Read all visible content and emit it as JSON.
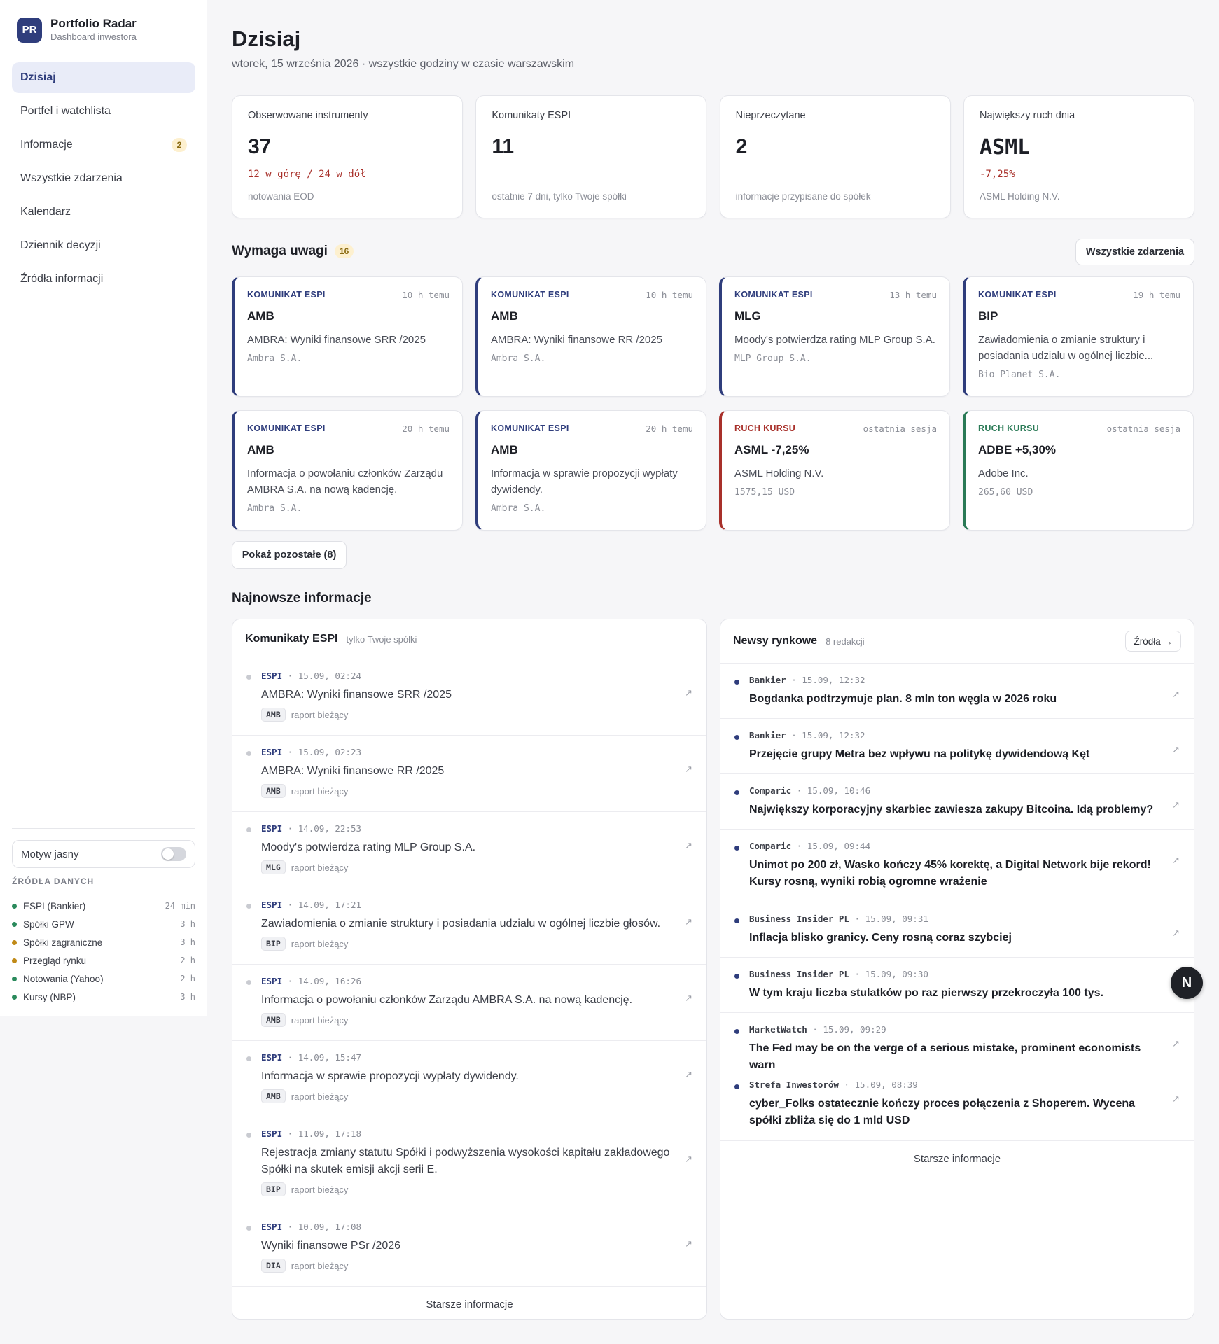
{
  "brand": {
    "logo": "PR",
    "title": "Portfolio Radar",
    "subtitle": "Dashboard inwestora"
  },
  "nav": [
    {
      "label": "Dzisiaj",
      "active": true
    },
    {
      "label": "Portfel i watchlista"
    },
    {
      "label": "Informacje",
      "badge": "2"
    },
    {
      "label": "Wszystkie zdarzenia"
    },
    {
      "label": "Kalendarz"
    },
    {
      "label": "Dziennik decyzji"
    },
    {
      "label": "Źródła informacji"
    }
  ],
  "theme": {
    "label": "Motyw jasny",
    "enabled": false
  },
  "sources": {
    "heading": "ŹRÓDŁA DANYCH",
    "items": [
      {
        "name": "ESPI (Bankier)",
        "age": "24 min",
        "color": "#2a8a5c"
      },
      {
        "name": "Spółki GPW",
        "age": "3 h",
        "color": "#2a8a5c"
      },
      {
        "name": "Spółki zagraniczne",
        "age": "3 h",
        "color": "#c08a17"
      },
      {
        "name": "Przegląd rynku",
        "age": "2 h",
        "color": "#c08a17"
      },
      {
        "name": "Notowania (Yahoo)",
        "age": "2 h",
        "color": "#2a8a5c"
      },
      {
        "name": "Kursy (NBP)",
        "age": "3 h",
        "color": "#2a8a5c"
      }
    ]
  },
  "page": {
    "title": "Dzisiaj",
    "subtitle": "wtorek, 15 września 2026 · wszystkie godziny w czasie warszawskim"
  },
  "stats": [
    {
      "label": "Obserwowane instrumenty",
      "value": "37",
      "detail": "12 w górę / 24 w dół",
      "foot": "notowania EOD"
    },
    {
      "label": "Komunikaty ESPI",
      "value": "11",
      "detail": "",
      "foot": "ostatnie 7 dni, tylko Twoje spółki"
    },
    {
      "label": "Nieprzeczytane",
      "value": "2",
      "detail": "",
      "foot": "informacje przypisane do spółek"
    },
    {
      "label": "Największy ruch dnia",
      "value": "ASML",
      "detail": "-7,25%",
      "foot": "ASML Holding N.V."
    }
  ],
  "attention": {
    "title": "Wymaga uwagi",
    "count": "16",
    "all_button": "Wszystkie zdarzenia",
    "show_more": "Pokaż pozostałe (8)",
    "cards": [
      {
        "type": "KOMUNIKAT ESPI",
        "time": "10 h temu",
        "ticker": "AMB",
        "title": "AMBRA: Wyniki finansowe SRR /2025",
        "company": "Ambra S.A.",
        "tone": "blue"
      },
      {
        "type": "KOMUNIKAT ESPI",
        "time": "10 h temu",
        "ticker": "AMB",
        "title": "AMBRA: Wyniki finansowe RR /2025",
        "company": "Ambra S.A.",
        "tone": "blue"
      },
      {
        "type": "KOMUNIKAT ESPI",
        "time": "13 h temu",
        "ticker": "MLG",
        "title": "Moody's potwierdza rating MLP Group S.A.",
        "company": "MLP Group S.A.",
        "tone": "blue"
      },
      {
        "type": "KOMUNIKAT ESPI",
        "time": "19 h temu",
        "ticker": "BIP",
        "title": "Zawiadomienia o zmianie struktury i posiadania udziału w ogólnej liczbie...",
        "company": "Bio Planet S.A.",
        "tone": "blue"
      },
      {
        "type": "KOMUNIKAT ESPI",
        "time": "20 h temu",
        "ticker": "AMB",
        "title": "Informacja o powołaniu członków Zarządu AMBRA S.A. na nową kadencję.",
        "company": "Ambra S.A.",
        "tone": "blue"
      },
      {
        "type": "KOMUNIKAT ESPI",
        "time": "20 h temu",
        "ticker": "AMB",
        "title": "Informacja w sprawie propozycji wypłaty dywidendy.",
        "company": "Ambra S.A.",
        "tone": "blue"
      },
      {
        "type": "RUCH KURSU",
        "time": "ostatnia sesja",
        "ticker": "ASML -7,25%",
        "title": "ASML Holding N.V.",
        "company": "1575,15 USD",
        "tone": "red"
      },
      {
        "type": "RUCH KURSU",
        "time": "ostatnia sesja",
        "ticker": "ADBE +5,30%",
        "title": "Adobe Inc.",
        "company": "265,60 USD",
        "tone": "green"
      }
    ]
  },
  "latest": {
    "title": "Najnowsze informacje",
    "espi": {
      "title": "Komunikaty ESPI",
      "hint": "tylko Twoje spółki",
      "footer": "Starsze informacje",
      "items": [
        {
          "source": "ESPI",
          "time": "15.09, 02:24",
          "title": "AMBRA: Wyniki finansowe SRR /2025",
          "ticker": "AMB",
          "kind": "raport bieżący"
        },
        {
          "source": "ESPI",
          "time": "15.09, 02:23",
          "title": "AMBRA: Wyniki finansowe RR /2025",
          "ticker": "AMB",
          "kind": "raport bieżący"
        },
        {
          "source": "ESPI",
          "time": "14.09, 22:53",
          "title": "Moody's potwierdza rating MLP Group S.A.",
          "ticker": "MLG",
          "kind": "raport bieżący"
        },
        {
          "source": "ESPI",
          "time": "14.09, 17:21",
          "title": "Zawiadomienia o zmianie struktury i posiadania udziału w ogólnej liczbie głosów.",
          "ticker": "BIP",
          "kind": "raport bieżący"
        },
        {
          "source": "ESPI",
          "time": "14.09, 16:26",
          "title": "Informacja o powołaniu członków Zarządu AMBRA S.A. na nową kadencję.",
          "ticker": "AMB",
          "kind": "raport bieżący"
        },
        {
          "source": "ESPI",
          "time": "14.09, 15:47",
          "title": "Informacja w sprawie propozycji wypłaty dywidendy.",
          "ticker": "AMB",
          "kind": "raport bieżący"
        },
        {
          "source": "ESPI",
          "time": "11.09, 17:18",
          "title": "Rejestracja zmiany statutu Spółki i podwyższenia wysokości kapitału zakładowego Spółki na skutek emisji akcji serii E.",
          "ticker": "BIP",
          "kind": "raport bieżący",
          "tall": true
        },
        {
          "source": "ESPI",
          "time": "10.09, 17:08",
          "title": "Wyniki finansowe PSr /2026",
          "ticker": "DIA",
          "kind": "raport bieżący"
        }
      ]
    },
    "news": {
      "title": "Newsy rynkowe",
      "hint": "8 redakcji",
      "sources_button": "Źródła →",
      "footer": "Starsze informacje",
      "items": [
        {
          "source": "Bankier",
          "time": "15.09, 12:32",
          "title": "Bogdanka podtrzymuje plan. 8 mln ton węgla w 2026 roku"
        },
        {
          "source": "Bankier",
          "time": "15.09, 12:32",
          "title": "Przejęcie grupy Metra bez wpływu na politykę dywidendową Kęt"
        },
        {
          "source": "Comparic",
          "time": "15.09, 10:46",
          "title": "Największy korporacyjny skarbiec zawiesza zakupy Bitcoina. Idą problemy?"
        },
        {
          "source": "Comparic",
          "time": "15.09, 09:44",
          "title": "Unimot po 200 zł, Wasko kończy 45% korektę, a Digital Network bije rekord! Kursy rosną, wyniki robią ogromne wrażenie",
          "tall": true
        },
        {
          "source": "Business Insider PL",
          "time": "15.09, 09:31",
          "title": "Inflacja blisko granicy. Ceny rosną coraz szybciej"
        },
        {
          "source": "Business Insider PL",
          "time": "15.09, 09:30",
          "title": "W tym kraju liczba stulatków po raz pierwszy przekroczyła 100 tys."
        },
        {
          "source": "MarketWatch",
          "time": "15.09, 09:29",
          "title": "The Fed may be on the verge of a serious mistake, prominent economists warn"
        },
        {
          "source": "Strefa Inwestorów",
          "time": "15.09, 08:39",
          "title": "cyber_Folks ostatecznie kończy proces połączenia z Shoperem. Wycena spółki zbliża się do 1 mld USD",
          "tall": true
        }
      ]
    }
  },
  "fab": {
    "label": "N"
  }
}
